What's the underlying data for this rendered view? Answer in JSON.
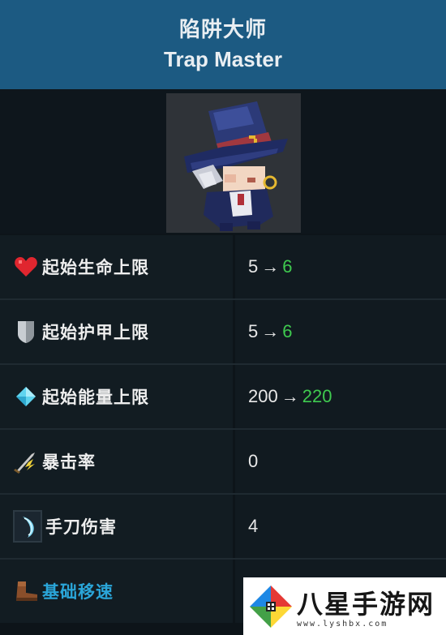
{
  "header": {
    "title_cn": "陷阱大师",
    "title_en": "Trap Master"
  },
  "portrait": {
    "icon": "trap-master-character-sprite"
  },
  "stats": [
    {
      "icon": "heart-icon",
      "label": "起始生命上限",
      "base": "5",
      "arrow": "→",
      "new": "6"
    },
    {
      "icon": "shield-icon",
      "label": "起始护甲上限",
      "base": "5",
      "arrow": "→",
      "new": "6"
    },
    {
      "icon": "diamond-icon",
      "label": "起始能量上限",
      "base": "200",
      "arrow": "→",
      "new": "220"
    },
    {
      "icon": "crit-sword-icon",
      "label": "暴击率",
      "base": "0"
    },
    {
      "icon": "hand-blade-icon",
      "label": "手刀伤害",
      "base": "4"
    },
    {
      "icon": "boot-icon",
      "label": "基础移速",
      "base": ""
    }
  ],
  "colors": {
    "header_bg": "#1c5a82",
    "row_bg": "#121c22",
    "new_value": "#3fca4f",
    "link": "#2aa5d8"
  },
  "watermark": {
    "text": "八星手游网",
    "url": "www.lyshbx.com"
  }
}
